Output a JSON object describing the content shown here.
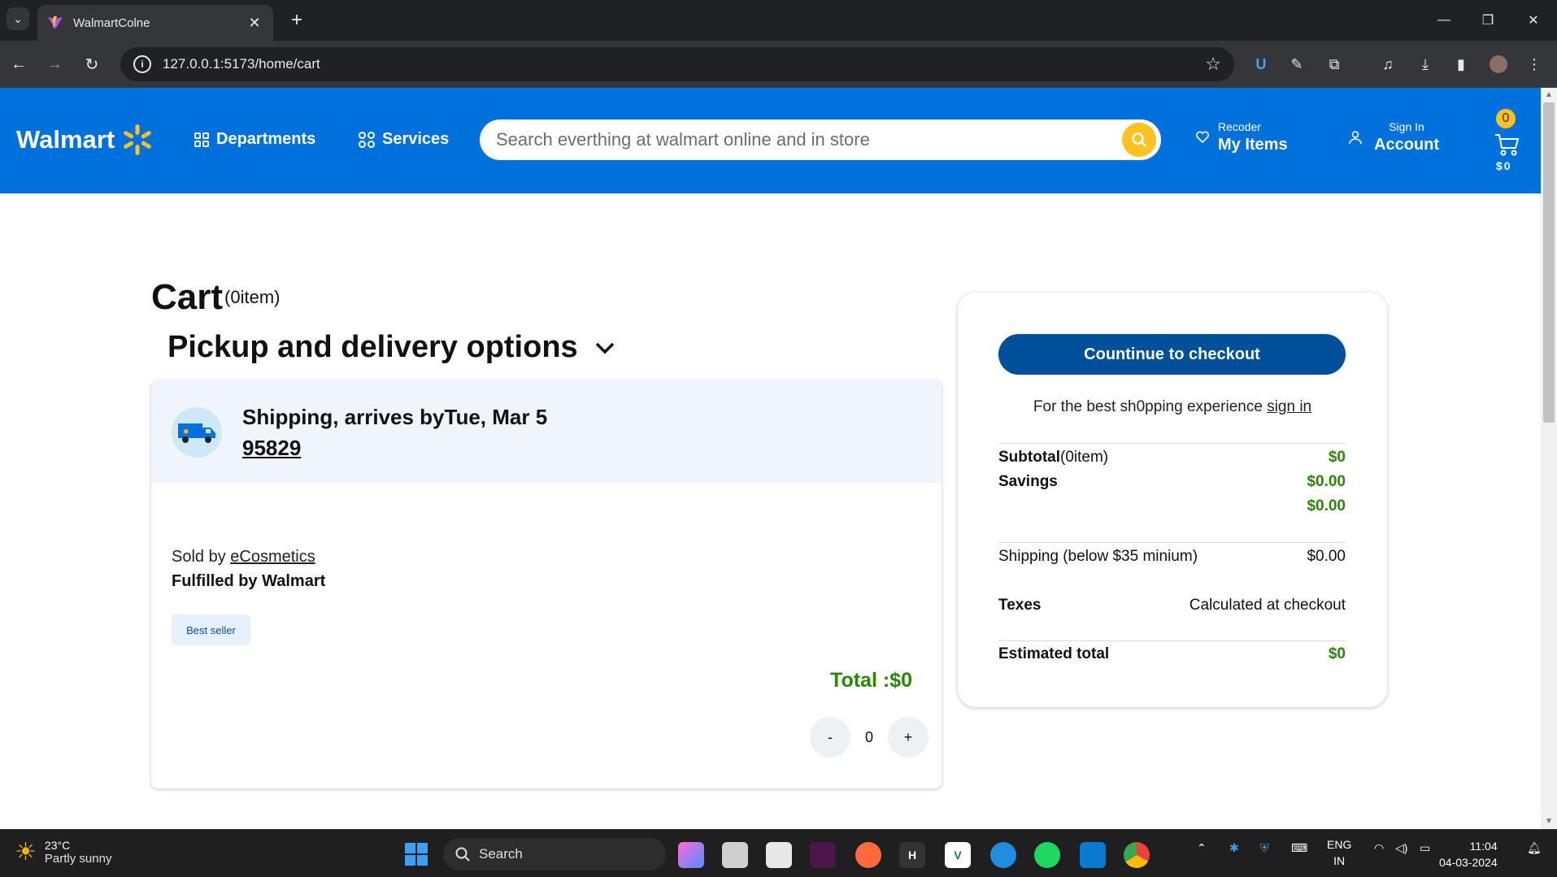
{
  "browser": {
    "tab_title": "WalmartColne",
    "url": "127.0.0.1:5173/home/cart"
  },
  "header": {
    "logo_text": "Walmart",
    "departments_label": "Departments",
    "services_label": "Services",
    "search_placeholder": "Search everthing at walmart online and in store",
    "reorder_small": "Recoder",
    "reorder_big": "My Items",
    "signin_small": "Sign In",
    "signin_big": "Account",
    "cart_count": "0",
    "cart_total": "$0",
    "brand_color": "#0071dc",
    "accent_color": "#ffc220"
  },
  "cart": {
    "title": "Cart",
    "item_count": "(0item)",
    "pickup_heading": "Pickup and delivery options",
    "shipping_text": "Shipping, arrives byTue, Mar 5",
    "zip": "95829",
    "sold_by_prefix": "Sold by",
    "seller": "eCosmetics",
    "fulfilled": "Fulfilled by Walmart",
    "badge": "Best seller",
    "item_total": "Total :$0",
    "qty_minus": "-",
    "qty_value": "0",
    "qty_plus": "+"
  },
  "summary": {
    "checkout_label": "Countinue to checkout",
    "best_exp_text": "For the best sh0pping experience",
    "sign_in_link": "sign in",
    "subtotal_label": "Subtotal",
    "subtotal_count": "(0item)",
    "subtotal_value": "$0",
    "savings_label": "Savings",
    "savings_value": "$0.00",
    "savings_value_2": "$0.00",
    "shipping_label": "Shipping (below $35 minium)",
    "shipping_value": "$0.00",
    "taxes_label": "Texes",
    "taxes_value": "Calculated at checkout",
    "estimated_label": "Estimated total",
    "estimated_value": "$0"
  },
  "taskbar": {
    "temperature": "23°C",
    "weather": "Partly sunny",
    "search_label": "Search",
    "lang_top": "ENG",
    "lang_bottom": "IN",
    "time": "11:04",
    "date": "04-03-2024"
  }
}
